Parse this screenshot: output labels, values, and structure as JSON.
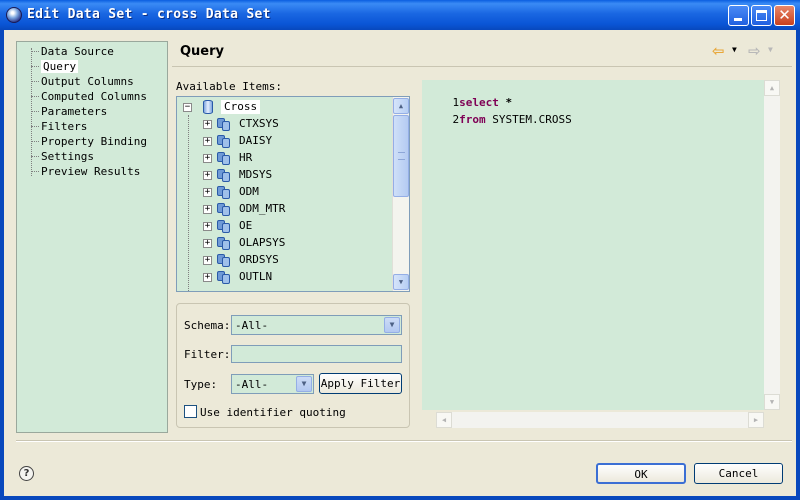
{
  "window": {
    "title": "Edit Data Set - cross Data Set",
    "close_glyph": "✕"
  },
  "nav": {
    "items": [
      {
        "label": "Data Source",
        "selected": false
      },
      {
        "label": "Query",
        "selected": true
      },
      {
        "label": "Output Columns",
        "selected": false
      },
      {
        "label": "Computed Columns",
        "selected": false
      },
      {
        "label": "Parameters",
        "selected": false
      },
      {
        "label": "Filters",
        "selected": false
      },
      {
        "label": "Property Binding",
        "selected": false
      },
      {
        "label": "Settings",
        "selected": false
      },
      {
        "label": "Preview Results",
        "selected": false
      }
    ]
  },
  "header": {
    "title": "Query",
    "back_glyph": "⇦",
    "forward_glyph": "⇨",
    "dropdown_glyph": "▼"
  },
  "available_items": {
    "label": "Available Items:",
    "root": {
      "label": "Cross",
      "expander": "−"
    },
    "schemas": [
      {
        "label": "CTXSYS",
        "expander": "+"
      },
      {
        "label": "DAISY",
        "expander": "+"
      },
      {
        "label": "HR",
        "expander": "+"
      },
      {
        "label": "MDSYS",
        "expander": "+"
      },
      {
        "label": "ODM",
        "expander": "+"
      },
      {
        "label": "ODM_MTR",
        "expander": "+"
      },
      {
        "label": "OE",
        "expander": "+"
      },
      {
        "label": "OLAPSYS",
        "expander": "+"
      },
      {
        "label": "ORDSYS",
        "expander": "+"
      },
      {
        "label": "OUTLN",
        "expander": "+"
      }
    ],
    "scroll_up": "▲",
    "scroll_down": "▼"
  },
  "filter": {
    "schema_label": "Schema:",
    "schema_value": "-All-",
    "filter_label": "Filter:",
    "filter_value": "",
    "type_label": "Type:",
    "type_value": "-All-",
    "apply_button": "Apply Filter",
    "quoting_label": "Use identifier quoting",
    "quoting_checked": false,
    "drop_glyph": "▼"
  },
  "editor": {
    "lines": [
      {
        "num": "1",
        "keyword": "select",
        "rest": " *"
      },
      {
        "num": "2",
        "keyword": "from",
        "rest": " SYSTEM.CROSS"
      }
    ],
    "up": "▲",
    "down": "▼",
    "left": "◀",
    "right": "▶"
  },
  "footer": {
    "help_glyph": "?",
    "ok_button": "OK",
    "cancel_button": "Cancel"
  }
}
